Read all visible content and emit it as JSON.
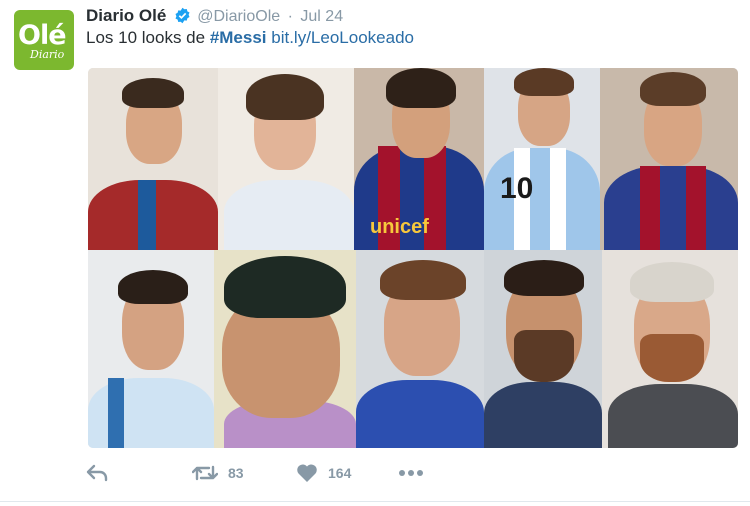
{
  "account": {
    "name": "Diario Olé",
    "handle": "@DiarioOle",
    "separator": "·",
    "date": "Jul 24",
    "avatar_text": "Olé",
    "avatar_script": "Diario"
  },
  "tweet": {
    "text_prefix": "Los 10 looks de ",
    "hashtag": "#Messi",
    "link": "bit.ly/LeoLookeado"
  },
  "media": {
    "shirt_text": "unicef",
    "shirt_number": "10"
  },
  "actions": {
    "retweet_count": "83",
    "like_count": "164"
  },
  "colors": {
    "link": "#2a6da6",
    "verified": "#1da1f2",
    "muted": "#8899a6",
    "avatar_bg": "#7cb82f"
  },
  "icons": [
    "verified-icon",
    "reply-icon",
    "retweet-icon",
    "like-icon",
    "more-icon"
  ]
}
